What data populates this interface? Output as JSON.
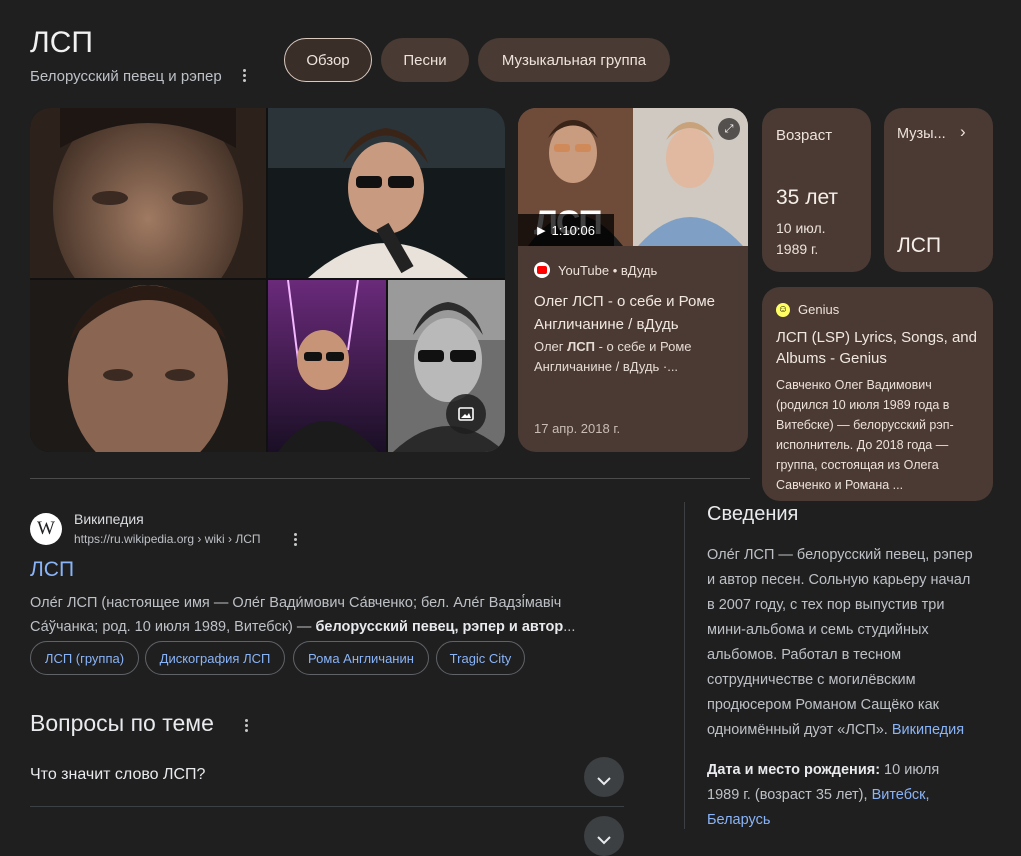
{
  "header": {
    "title": "ЛСП",
    "subtitle": "Белорусский певец и рэпер",
    "tabs": [
      {
        "label": "Обзор",
        "active": true
      },
      {
        "label": "Песни",
        "active": false
      },
      {
        "label": "Музыкальная группа",
        "active": false
      }
    ]
  },
  "video": {
    "source": "YouTube • вДудь",
    "duration": "1:10:06",
    "thumb_text": "ЛСП",
    "title": "Олег ЛСП - о себе и Роме Англичанине / вДудь",
    "snippet_pre": "Олег ",
    "snippet_bold": "ЛСП",
    "snippet_post": " - о себе и Роме Англичанине / вДудь ·...",
    "date": "17 апр. 2018 г."
  },
  "age_card": {
    "label": "Возраст",
    "value": "35 лет",
    "date_line1": "10 июл.",
    "date_line2": "1989 г."
  },
  "music_card": {
    "label": "Музы...",
    "value": "ЛСП"
  },
  "genius": {
    "source": "Genius",
    "title": "ЛСП (LSP) Lyrics, Songs, and Albums - Genius",
    "snippet": "Савченко Олег Вадимович (родился 10 июля 1989 года в Витебске) — белорусский рэп-исполнитель. До 2018 года — группа, состоящая из Олега Савченко и Романа ..."
  },
  "wiki": {
    "site": "Википедия",
    "logo": "W",
    "url": "https://ru.wikipedia.org › wiki › ЛСП",
    "title": "ЛСП",
    "snippet_line1": "Оле́г ЛСП (настоящее имя — Оле́г Вади́мович Са́вченко; бел. Але́г Вадзі́мавіч",
    "snippet_line2_pre": "Са́ўчанка; род. 10 июля 1989, Витебск) — ",
    "snippet_line2_bold": "белорусский певец, рэпер и автор",
    "snippet_line2_ellipsis": "...",
    "pills": [
      "ЛСП (группа)",
      "Дискография ЛСП",
      "Рома Англичанин",
      "Tragic City"
    ]
  },
  "faq": {
    "title": "Вопросы по теме",
    "questions": [
      "Что значит слово ЛСП?"
    ]
  },
  "info": {
    "title": "Сведения",
    "lines": [
      "Оле́г ЛСП — белорусский певец, рэпер",
      "и автор песен. Сольную карьеру начал",
      "в 2007 году, с тех пор выпустив три",
      "мини-альбома и семь студийных",
      "альбомов. Работал в тесном",
      "сотрудничестве с могилёвским",
      "продюсером Романом Сащёко как",
      "одноимённый дуэт «ЛСП»."
    ],
    "source_link": "Википедия",
    "birth_label": "Дата и место рождения:",
    "birth_value1": " 10 июля",
    "birth_value2": "1989 г. (возраст 35 лет), ",
    "birth_city": "Витебск,",
    "birth_country": "Беларусь"
  },
  "colors": {
    "page_bg": "#1f1f1f",
    "card_bg": "#4a3a33",
    "link": "#8ab4f8",
    "chip_bg": "#493a33"
  }
}
